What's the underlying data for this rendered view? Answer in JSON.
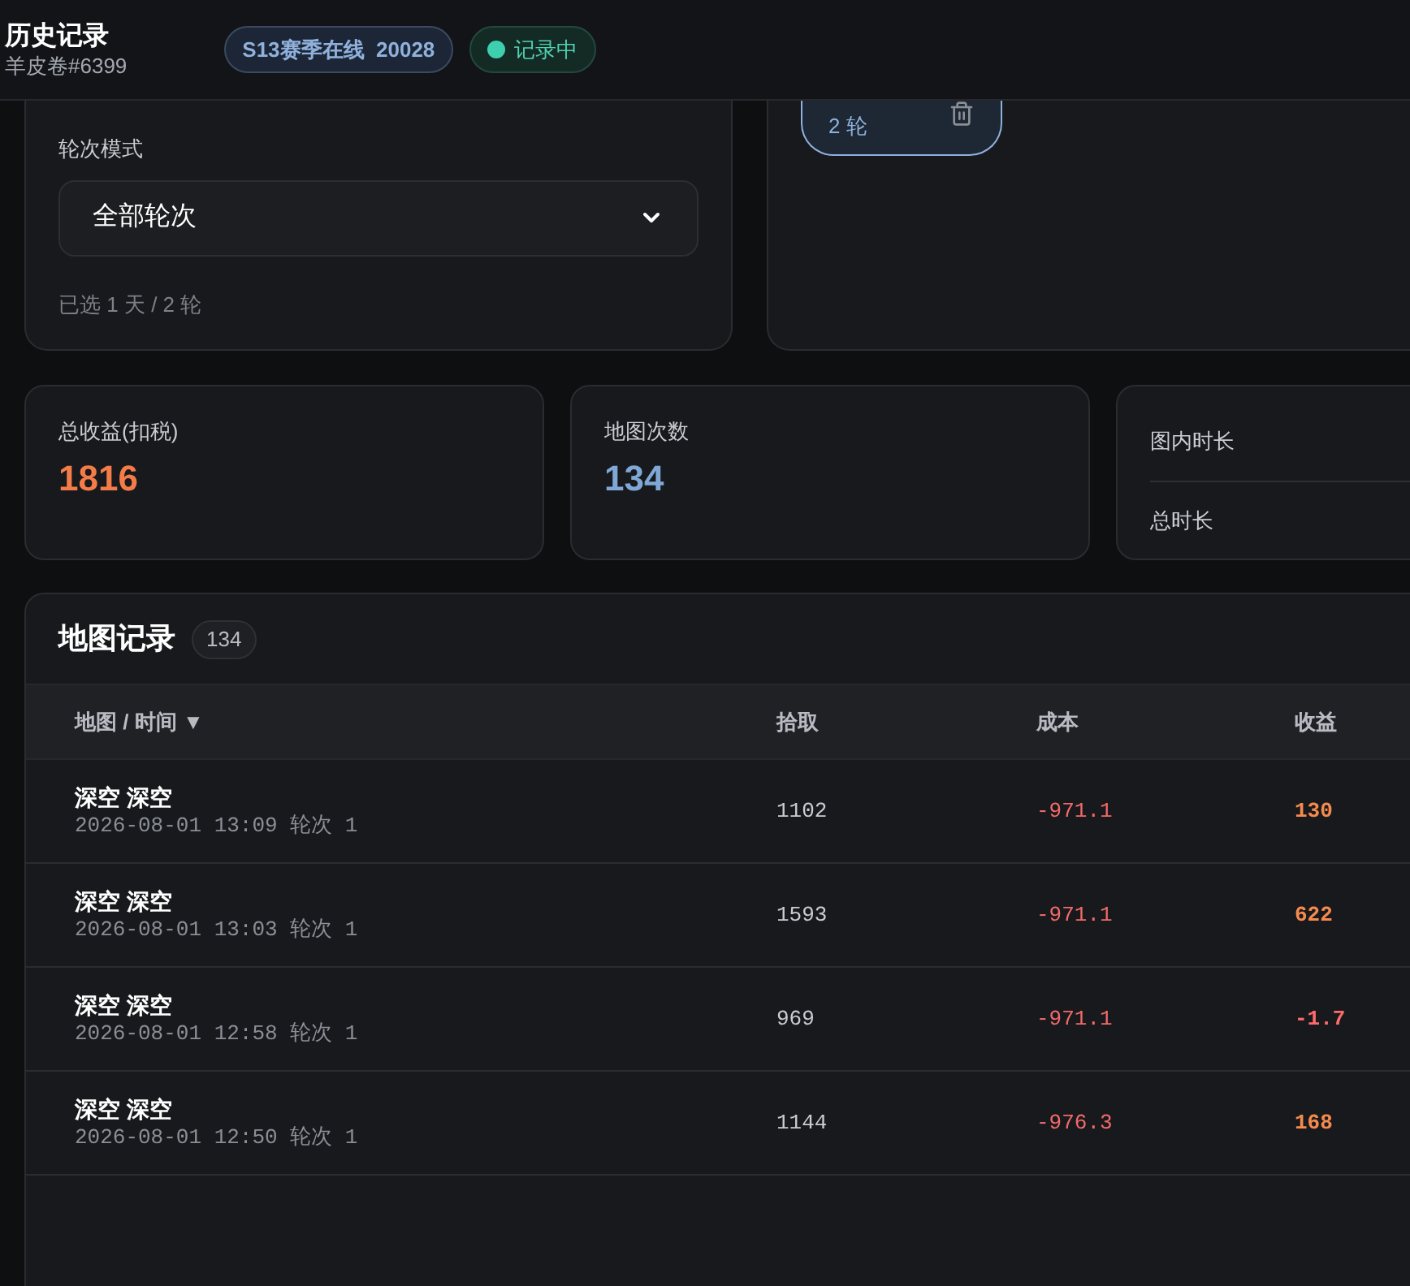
{
  "header": {
    "title": "历史记录",
    "subtitle": "羊皮卷#6399",
    "badges": [
      {
        "kind": "info",
        "text": "S13赛季在线  20028"
      },
      {
        "kind": "status",
        "text": "记录中"
      }
    ]
  },
  "filter": {
    "label": "轮次模式",
    "select_value": "全部轮次",
    "summary": "已选 1 天 / 2 轮"
  },
  "date_chips": [
    {
      "rounds": "2 轮",
      "selected": true
    }
  ],
  "stats": [
    {
      "kind": "value",
      "label": "总收益(扣税)",
      "value": "1816",
      "color": "#f47c48"
    },
    {
      "kind": "value",
      "label": "地图次数",
      "value": "134",
      "color": "#7fa8d6"
    },
    {
      "kind": "durations",
      "labels": [
        "图内时长",
        "总时长"
      ]
    }
  ],
  "records": {
    "title": "地图记录",
    "count": "134",
    "columns": [
      "地图 / 时间 ▼",
      "拾取",
      "成本",
      "收益"
    ],
    "rows": [
      {
        "map": "深空 深空",
        "time": "2026-08-01 13:09 轮次 1",
        "pickup": "1102",
        "cost": "-971.1",
        "profit": "130",
        "negative": false
      },
      {
        "map": "深空 深空",
        "time": "2026-08-01 13:03 轮次 1",
        "pickup": "1593",
        "cost": "-971.1",
        "profit": "622",
        "negative": false
      },
      {
        "map": "深空 深空",
        "time": "2026-08-01 12:58 轮次 1",
        "pickup": "969",
        "cost": "-971.1",
        "profit": "-1.7",
        "negative": true
      },
      {
        "map": "深空 深空",
        "time": "2026-08-01 12:50 轮次 1",
        "pickup": "1144",
        "cost": "-976.3",
        "profit": "168",
        "negative": false
      }
    ]
  }
}
